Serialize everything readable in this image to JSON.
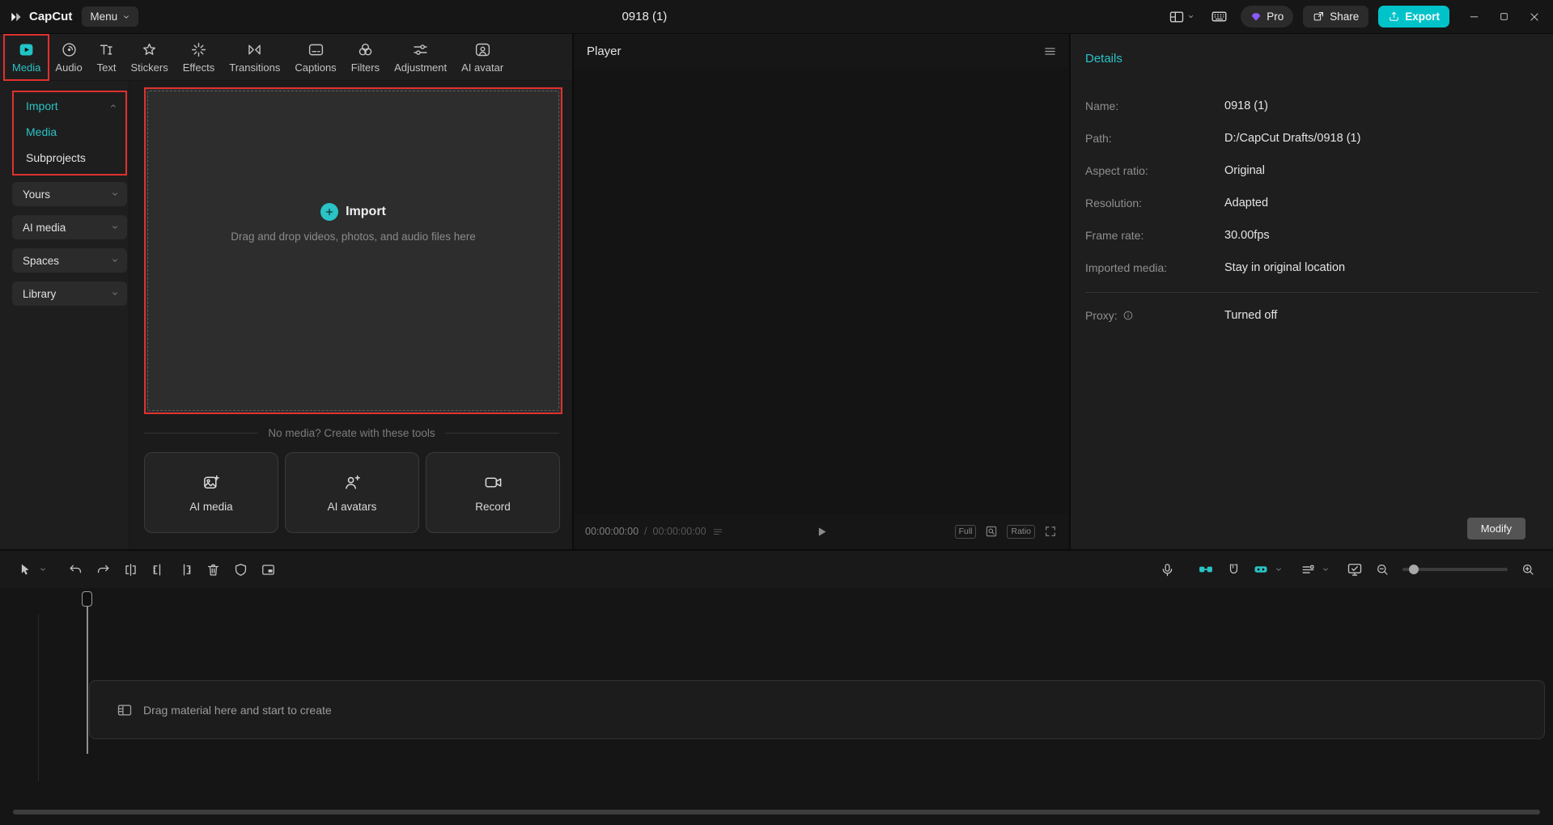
{
  "accent_color": "#2ac3c6",
  "annotation_color": "#e0312f",
  "titlebar": {
    "logo_text": "CapCut",
    "menu_label": "Menu",
    "project_title": "0918 (1)",
    "pro_label": "Pro",
    "share_label": "Share",
    "export_label": "Export"
  },
  "ribbon": {
    "tabs": [
      {
        "label": "Media",
        "active": true
      },
      {
        "label": "Audio",
        "active": false
      },
      {
        "label": "Text",
        "active": false
      },
      {
        "label": "Stickers",
        "active": false
      },
      {
        "label": "Effects",
        "active": false
      },
      {
        "label": "Transitions",
        "active": false
      },
      {
        "label": "Captions",
        "active": false
      },
      {
        "label": "Filters",
        "active": false
      },
      {
        "label": "Adjustment",
        "active": false
      },
      {
        "label": "AI avatar",
        "active": false
      }
    ]
  },
  "sidebar": {
    "import_label": "Import",
    "media_label": "Media",
    "subprojects_label": "Subprojects",
    "groups": [
      {
        "label": "Yours"
      },
      {
        "label": "AI media"
      },
      {
        "label": "Spaces"
      },
      {
        "label": "Library"
      }
    ]
  },
  "media_panel": {
    "import_button": "Import",
    "import_hint": "Drag and drop videos, photos, and audio files here",
    "tools_divider": "No media? Create with these tools",
    "tools": [
      {
        "label": "AI media"
      },
      {
        "label": "AI avatars"
      },
      {
        "label": "Record"
      }
    ]
  },
  "player": {
    "title": "Player",
    "current_time": "00:00:00:00",
    "time_separator": "/",
    "total_time": "00:00:00:00",
    "full_label": "Full",
    "ratio_label": "Ratio"
  },
  "details": {
    "title": "Details",
    "fields": [
      {
        "label": "Name:",
        "value": "0918 (1)"
      },
      {
        "label": "Path:",
        "value": "D:/CapCut Drafts/0918 (1)"
      },
      {
        "label": "Aspect ratio:",
        "value": "Original"
      },
      {
        "label": "Resolution:",
        "value": "Adapted"
      },
      {
        "label": "Frame rate:",
        "value": "30.00fps"
      },
      {
        "label": "Imported media:",
        "value": "Stay in original location"
      }
    ],
    "proxy_label": "Proxy:",
    "proxy_value": "Turned off",
    "modify_label": "Modify"
  },
  "timeline": {
    "empty_hint": "Drag material here and start to create"
  },
  "icons": [
    "capcut-logo-icon",
    "menu-chevron-icon",
    "layout-icon",
    "keyboard-icon",
    "pro-diamond-icon",
    "share-icon",
    "export-icon",
    "minimize-icon",
    "maximize-icon",
    "close-icon",
    "media-tab-icon",
    "audio-tab-icon",
    "text-tab-icon",
    "stickers-tab-icon",
    "effects-tab-icon",
    "transitions-tab-icon",
    "captions-tab-icon",
    "filters-tab-icon",
    "adjustment-tab-icon",
    "ai-avatar-tab-icon",
    "plus-icon",
    "ai-media-icon",
    "ai-avatars-icon",
    "record-icon",
    "player-menu-icon",
    "play-icon",
    "zoom-fit-icon",
    "fullscreen-icon",
    "info-icon",
    "select-tool-icon",
    "undo-icon",
    "redo-icon",
    "split-icon",
    "trim-left-icon",
    "trim-right-icon",
    "delete-icon",
    "mask-icon",
    "pip-icon",
    "mic-icon",
    "link-tracks-icon",
    "magnet-icon",
    "auto-snap-icon",
    "track-options-icon",
    "preview-monitor-icon",
    "zoom-out-icon",
    "zoom-in-icon",
    "film-track-icon"
  ]
}
